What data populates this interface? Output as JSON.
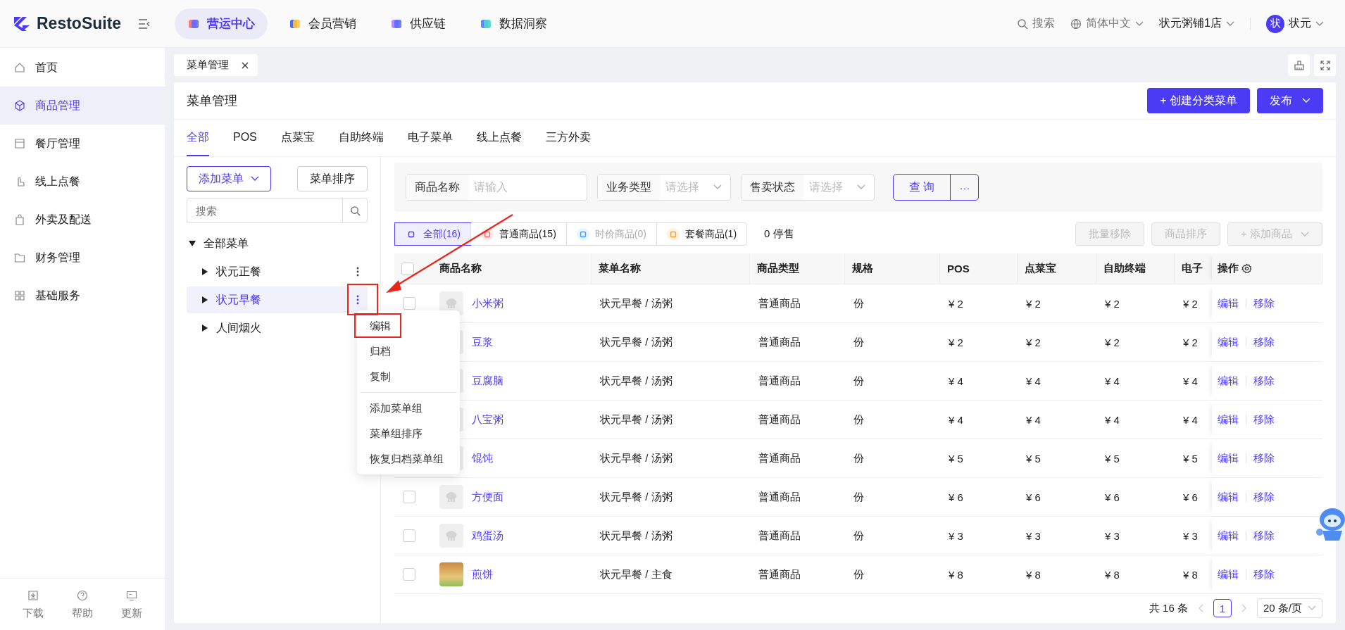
{
  "logo": "RestoSuite",
  "top_nav": [
    {
      "label": "营运中心",
      "selected": true
    },
    {
      "label": "会员营销",
      "selected": false
    },
    {
      "label": "供应链",
      "selected": false
    },
    {
      "label": "数据洞察",
      "selected": false
    }
  ],
  "header_right": {
    "search": "搜索",
    "language": "简体中文",
    "store": "状元粥铺1店",
    "avatar": "状",
    "user": "状元"
  },
  "sidebar": {
    "items": [
      {
        "label": "首页",
        "selected": false
      },
      {
        "label": "商品管理",
        "selected": true
      },
      {
        "label": "餐厅管理",
        "selected": false
      },
      {
        "label": "线上点餐",
        "selected": false
      },
      {
        "label": "外卖及配送",
        "selected": false
      },
      {
        "label": "财务管理",
        "selected": false
      },
      {
        "label": "基础服务",
        "selected": false
      }
    ],
    "footer": [
      "下载",
      "帮助",
      "更新"
    ]
  },
  "page_tabs": [
    {
      "label": "菜单管理"
    }
  ],
  "card": {
    "title": "菜单管理",
    "create_button": "+ 创建分类菜单",
    "publish_button": "发布"
  },
  "channel_tabs": [
    {
      "label": "全部",
      "selected": true
    },
    {
      "label": "POS",
      "selected": false
    },
    {
      "label": "点菜宝",
      "selected": false
    },
    {
      "label": "自助终端",
      "selected": false
    },
    {
      "label": "电子菜单",
      "selected": false
    },
    {
      "label": "线上点餐",
      "selected": false
    },
    {
      "label": "三方外卖",
      "selected": false
    }
  ],
  "menu_panel": {
    "add_button": "添加菜单",
    "sort_button": "菜单排序",
    "search_placeholder": "搜索",
    "tree": [
      {
        "label": "全部菜单",
        "expanded": true,
        "children": [
          {
            "label": "状元正餐",
            "expanded": false,
            "selected": false,
            "show_more": true
          },
          {
            "label": "状元早餐",
            "expanded": false,
            "selected": true,
            "show_more": true
          },
          {
            "label": "人间烟火",
            "expanded": false,
            "selected": false,
            "show_more": false
          }
        ]
      }
    ]
  },
  "context_menu": {
    "groups": [
      [
        "编辑",
        "归档",
        "复制"
      ],
      [
        "添加菜单组",
        "菜单组排序",
        "恢复归档菜单组"
      ]
    ]
  },
  "filters": [
    {
      "kind": "input",
      "label": "商品名称",
      "placeholder": "请输入"
    },
    {
      "kind": "select",
      "label": "业务类型",
      "placeholder": "请选择"
    },
    {
      "kind": "select",
      "label": "售卖状态",
      "placeholder": "请选择"
    }
  ],
  "query_button": "查 询",
  "more_button": "···",
  "type_segments": [
    {
      "label": "全部(16)",
      "selected": true,
      "disabled": false
    },
    {
      "label": "普通商品(15)",
      "selected": false,
      "disabled": false
    },
    {
      "label": "时价商品(0)",
      "selected": false,
      "disabled": true
    },
    {
      "label": "套餐商品(1)",
      "selected": false,
      "disabled": false
    }
  ],
  "stopped": "0 停售",
  "actions": [
    {
      "label": "批量移除",
      "disabled": true
    },
    {
      "label": "商品排序",
      "disabled": true
    },
    {
      "label": "+ 添加商品",
      "disabled": true
    }
  ],
  "table": {
    "columns": [
      "商品名称",
      "菜单名称",
      "商品类型",
      "规格",
      "POS",
      "点菜宝",
      "自助终端",
      "电子",
      "操作"
    ],
    "all_checked": false,
    "rows": [
      {
        "kind": "placeholder",
        "checked": false,
        "cells": [
          "小米粥",
          "状元早餐 / 汤粥",
          "普通商品",
          "份",
          "¥ 2",
          "¥ 2",
          "¥ 2",
          "¥ 2"
        ],
        "actions": [
          "编辑",
          "移除"
        ]
      },
      {
        "kind": "placeholder",
        "cells": [
          "豆浆",
          "状元早餐 / 汤粥",
          "普通商品",
          "份",
          "¥ 2",
          "¥ 2",
          "¥ 2",
          "¥ 2"
        ],
        "actions": [
          "编辑",
          "移除"
        ]
      },
      {
        "kind": "placeholder",
        "cells": [
          "豆腐脑",
          "状元早餐 / 汤粥",
          "普通商品",
          "份",
          "¥ 4",
          "¥ 4",
          "¥ 4",
          "¥ 4"
        ],
        "actions": [
          "编辑",
          "移除"
        ]
      },
      {
        "kind": "placeholder",
        "cells": [
          "八宝粥",
          "状元早餐 / 汤粥",
          "普通商品",
          "份",
          "¥ 4",
          "¥ 4",
          "¥ 4",
          "¥ 4"
        ],
        "actions": [
          "编辑",
          "移除"
        ]
      },
      {
        "kind": "placeholder",
        "cells": [
          "馄饨",
          "状元早餐 / 汤粥",
          "普通商品",
          "份",
          "¥ 5",
          "¥ 5",
          "¥ 5",
          "¥ 5"
        ],
        "actions": [
          "编辑",
          "移除"
        ]
      },
      {
        "kind": "placeholder",
        "checked": false,
        "cells": [
          "方便面",
          "状元早餐 / 汤粥",
          "普通商品",
          "份",
          "¥ 6",
          "¥ 6",
          "¥ 6",
          "¥ 6"
        ],
        "actions": [
          "编辑",
          "移除"
        ]
      },
      {
        "kind": "placeholder",
        "checked": false,
        "cells": [
          "鸡蛋汤",
          "状元早餐 / 汤粥",
          "普通商品",
          "份",
          "¥ 3",
          "¥ 3",
          "¥ 3",
          "¥ 3"
        ],
        "actions": [
          "编辑",
          "移除"
        ]
      },
      {
        "kind": "photo",
        "checked": false,
        "cells": [
          "煎饼",
          "状元早餐 / 主食",
          "普通商品",
          "份",
          "¥ 8",
          "¥ 8",
          "¥ 8",
          "¥ 8"
        ],
        "actions": [
          "编辑",
          "移除"
        ]
      }
    ]
  },
  "pagination": {
    "total": "共 16 条",
    "pages": [
      {
        "label": "1",
        "selected": true
      }
    ],
    "page_size": "20 条/页"
  }
}
